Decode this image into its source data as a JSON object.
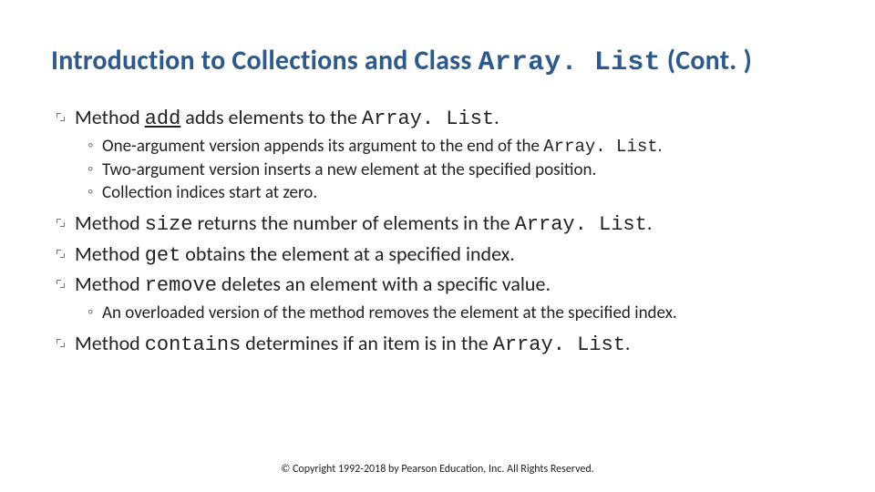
{
  "title": {
    "prefix": "Introduction to Collections and Class ",
    "code": "Array. List",
    "suffix": " (Cont. )"
  },
  "bullets": {
    "add": {
      "m": "Method ",
      "kw": "add",
      "rest": " adds elements to the ",
      "cls": "Array. List",
      "p": ".",
      "subs": {
        "a_pre": "One-argument version appends its argument to the end of the ",
        "a_cls": "Array. List",
        "a_p": ".",
        "b": "Two-argument version inserts a new element at the specified position.",
        "c": "Collection indices start at zero."
      }
    },
    "size": {
      "m": "Method ",
      "kw": "size",
      "rest": " returns the number of elements in the ",
      "cls": "Array. List",
      "p": "."
    },
    "get": {
      "m": "Method ",
      "kw": "get",
      "rest": " obtains the element at a specified index."
    },
    "remove": {
      "m": "Method ",
      "kw": "remove",
      "rest": " deletes an element with a specific value.",
      "subs": {
        "a": "An overloaded version of the method removes the element at the specified index."
      }
    },
    "contains": {
      "m": "Method ",
      "kw": "contains",
      "rest": " determines if an item is in the ",
      "cls": "Array. List",
      "p": "."
    }
  },
  "footer": "© Copyright 1992-2018 by Pearson Education, Inc. All Rights Reserved."
}
